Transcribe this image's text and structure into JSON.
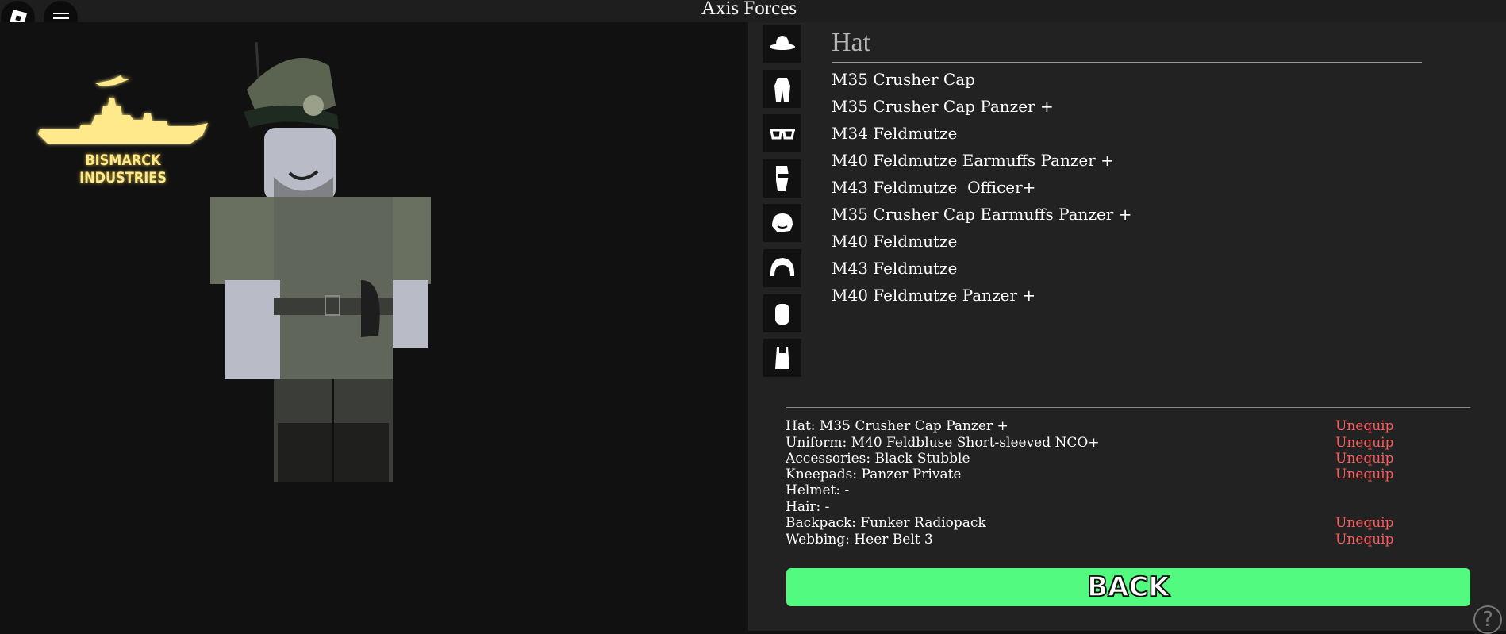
{
  "window": {
    "title": "Axis Forces"
  },
  "logo": {
    "text": "BISMARCK INDUSTRIES",
    "color": "#ffe98a"
  },
  "categories": [
    {
      "name": "hat-icon"
    },
    {
      "name": "uniform-icon"
    },
    {
      "name": "glasses-icon"
    },
    {
      "name": "kneepads-icon"
    },
    {
      "name": "helmet-icon"
    },
    {
      "name": "hair-icon"
    },
    {
      "name": "backpack-icon"
    },
    {
      "name": "webbing-icon"
    }
  ],
  "section": {
    "heading": "Hat",
    "items": [
      "M35 Crusher Cap",
      "M35 Crusher Cap Panzer +",
      "M34 Feldmutze",
      "M40 Feldmutze Earmuffs Panzer +",
      "M43 Feldmutze  Officer+",
      "M35 Crusher Cap Earmuffs Panzer +",
      "M40 Feldmutze",
      "M43 Feldmutze",
      "M40 Feldmutze Panzer +"
    ]
  },
  "equipped": [
    {
      "label": "Hat: M35 Crusher Cap Panzer +",
      "action": "Unequip"
    },
    {
      "label": "Uniform: M40 Feldbluse Short-sleeved NCO+",
      "action": "Unequip"
    },
    {
      "label": "Accessories: Black Stubble",
      "action": "Unequip"
    },
    {
      "label": "Kneepads: Panzer Private",
      "action": "Unequip"
    },
    {
      "label": "Helmet: -",
      "action": ""
    },
    {
      "label": "Hair: -",
      "action": ""
    },
    {
      "label": "Backpack: Funker Radiopack",
      "action": "Unequip"
    },
    {
      "label": "Webbing: Heer Belt 3",
      "action": "Unequip"
    }
  ],
  "back_button": {
    "label": "BACK",
    "color": "#52fa80"
  },
  "help": {
    "label": "?"
  },
  "colors": {
    "unequip": "#ff5a5a",
    "panel": "#222222",
    "background": "#111111"
  }
}
